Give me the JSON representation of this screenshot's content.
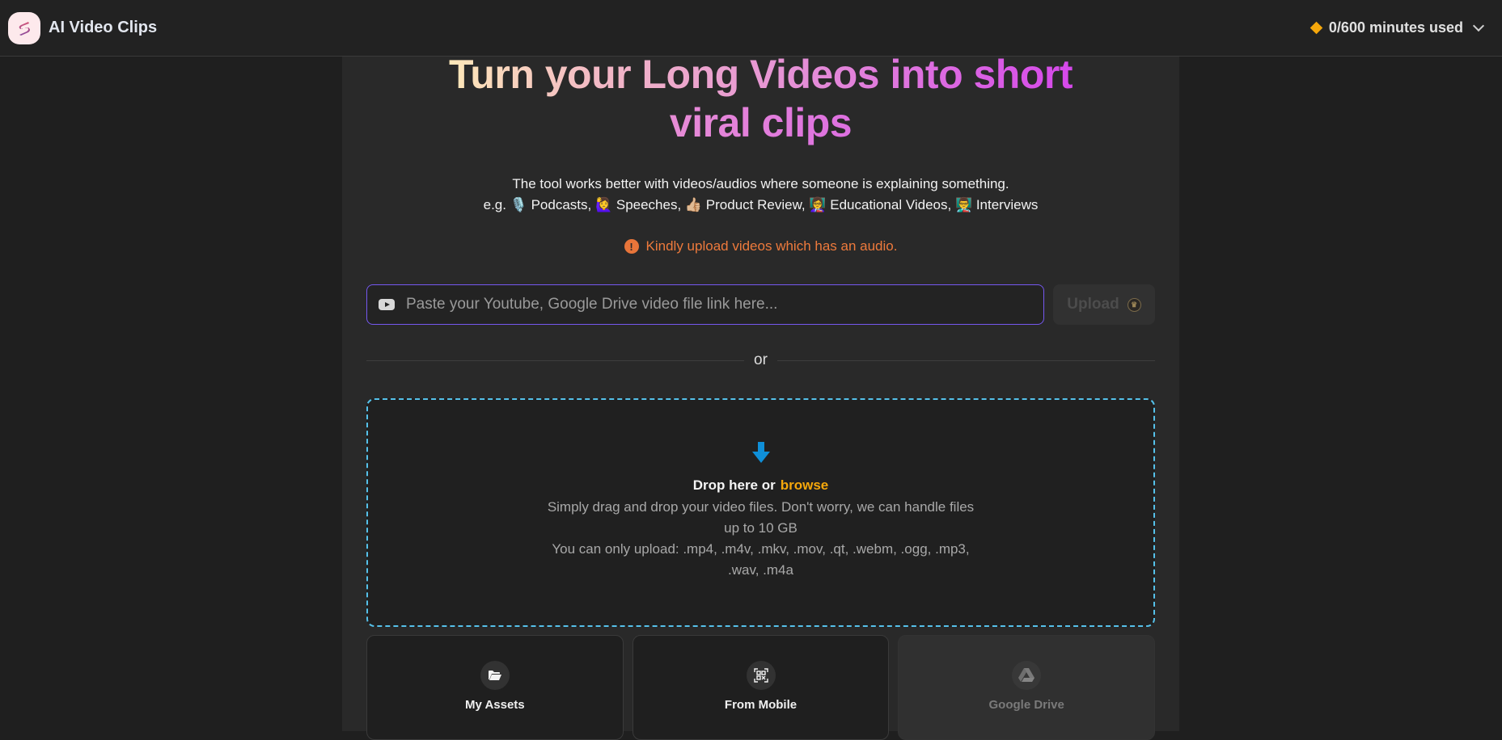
{
  "header": {
    "app_name": "AI Video Clips",
    "usage": "0/600 minutes used",
    "usage_icon": "diamond-icon",
    "menu_icon": "chevron-down-icon",
    "accent_color": "#f5a70b"
  },
  "hero": {
    "title_line1": "Turn your Long Videos into short",
    "title_line2": "viral clips"
  },
  "subtitle": {
    "line1": "The tool works better with videos/audios where someone is explaining something.",
    "line2": "e.g. 🎙️ Podcasts, 🙋‍♀️ Speeches, 👍🏼 Product Review, 👩‍🏫 Educational Videos, 👨‍🏫 Interviews"
  },
  "warning": {
    "icon": "exclamation-icon",
    "text": "Kindly upload videos which has an audio.",
    "color": "#ee7a3c"
  },
  "link_input": {
    "icon": "youtube-icon",
    "placeholder": "Paste your Youtube, Google Drive video file link here...",
    "value": ""
  },
  "upload_button": {
    "label": "Upload",
    "badge_icon": "crown-icon",
    "badge_glyph": "♛"
  },
  "divider": {
    "text": "or"
  },
  "dropzone": {
    "icon": "arrow-down-icon",
    "title": "Drop here or",
    "browse_label": "browse",
    "description_1": "Simply drag and drop your video files. Don't worry, we can handle files up to 10 GB",
    "description_2": "You can only upload: .mp4, .m4v, .mkv, .mov, .qt, .webm, .ogg, .mp3, .wav, .m4a",
    "border_color": "#55c1ea"
  },
  "sources": [
    {
      "label": "My Assets",
      "icon": "folder-open-icon",
      "disabled": false
    },
    {
      "label": "From Mobile",
      "icon": "qr-scan-icon",
      "disabled": false
    },
    {
      "label": "Google Drive",
      "icon": "google-drive-icon",
      "disabled": true
    }
  ]
}
